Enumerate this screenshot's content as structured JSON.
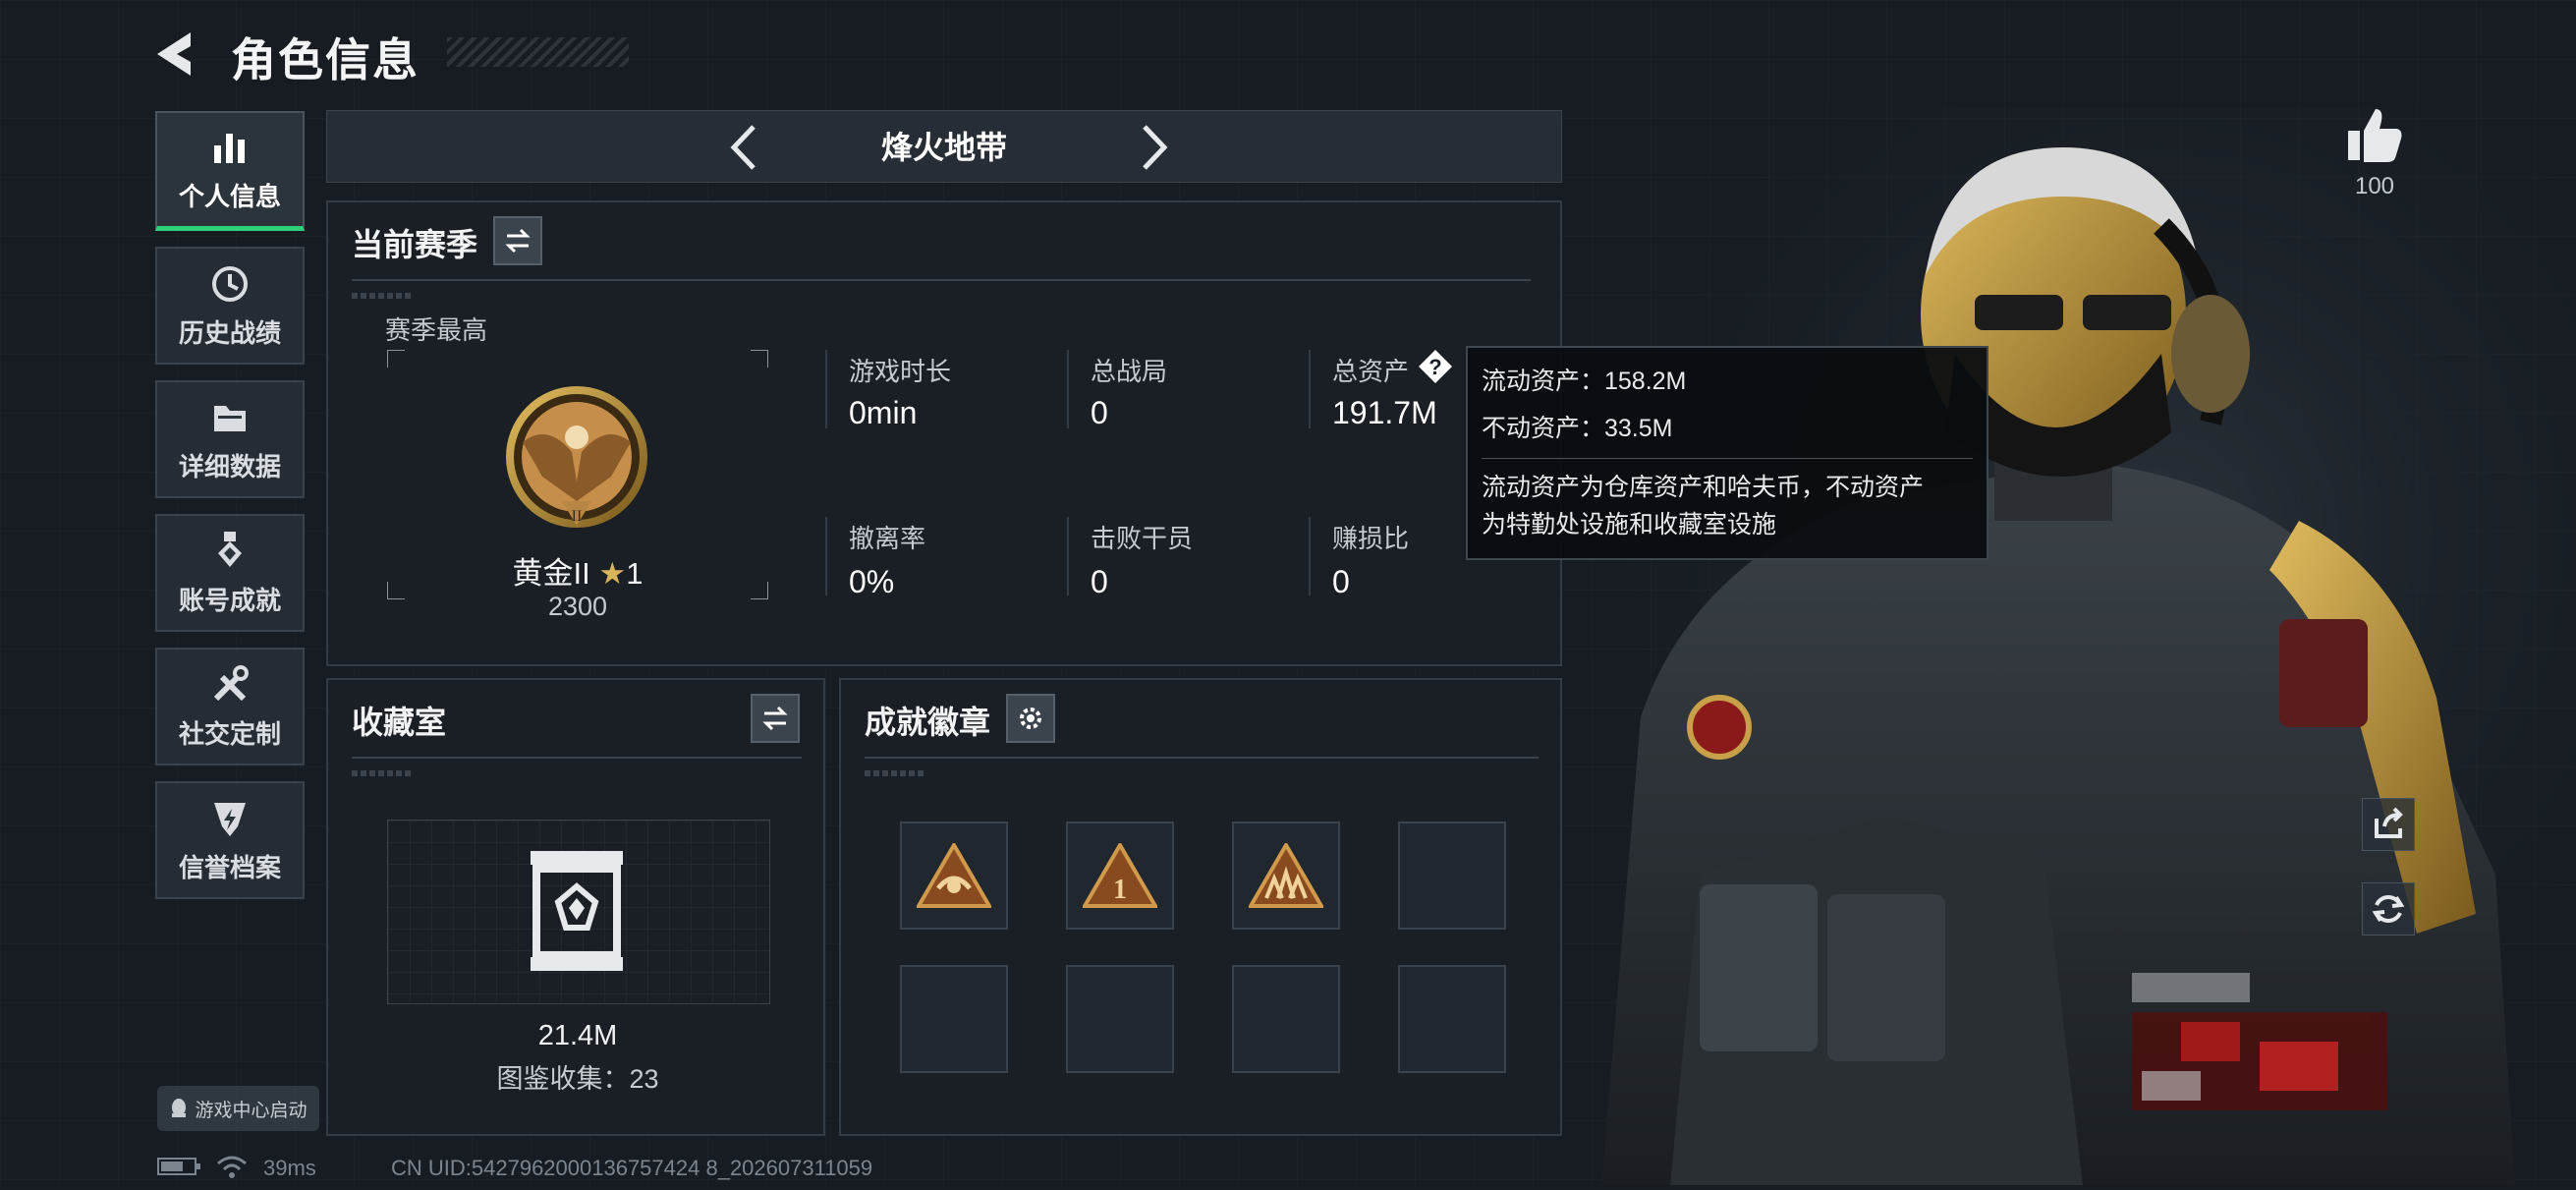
{
  "header": {
    "title": "角色信息"
  },
  "sidebar": {
    "items": [
      {
        "label": "个人信息",
        "icon": "bar-chart-icon",
        "active": true
      },
      {
        "label": "历史战绩",
        "icon": "history-icon",
        "active": false
      },
      {
        "label": "详细数据",
        "icon": "folder-icon",
        "active": false
      },
      {
        "label": "账号成就",
        "icon": "medal-icon",
        "active": false
      },
      {
        "label": "社交定制",
        "icon": "tools-icon",
        "active": false
      },
      {
        "label": "信誉档案",
        "icon": "shield-bolt-icon",
        "active": false
      }
    ],
    "qq_launch_label": "游戏中心启动"
  },
  "mode_selector": {
    "label": "烽火地带"
  },
  "season": {
    "title": "当前赛季",
    "best_label": "赛季最高",
    "rank_name": "黄金II",
    "rank_stars": "1",
    "rank_score": "2300",
    "stats": [
      {
        "label": "游戏时长",
        "value": "0min"
      },
      {
        "label": "总战局",
        "value": "0"
      },
      {
        "label": "总资产",
        "value": "191.7M"
      },
      {
        "label": "撤离率",
        "value": "0%"
      },
      {
        "label": "击败干员",
        "value": "0"
      },
      {
        "label": "赚损比",
        "value": "0"
      }
    ]
  },
  "tooltip": {
    "liquid": "流动资产：158.2M",
    "fixed": "不动资产：33.5M",
    "desc_line1": "流动资产为仓库资产和哈夫币，不动资产",
    "desc_line2": "为特勤处设施和收藏室设施"
  },
  "collection": {
    "title": "收藏室",
    "value": "21.4M",
    "catalog": "图鉴收集：23"
  },
  "achievements": {
    "title": "成就徽章",
    "badge_count": 3,
    "slot_count": 8
  },
  "right_panel": {
    "likes": "100"
  },
  "footer": {
    "ping": "39ms",
    "uid": "CN UID:5427962000136757424 8_202607311059"
  },
  "colors": {
    "accent_green": "#2fd07a",
    "gold": "#c9a24a",
    "panel_bg": "#1a2026"
  }
}
